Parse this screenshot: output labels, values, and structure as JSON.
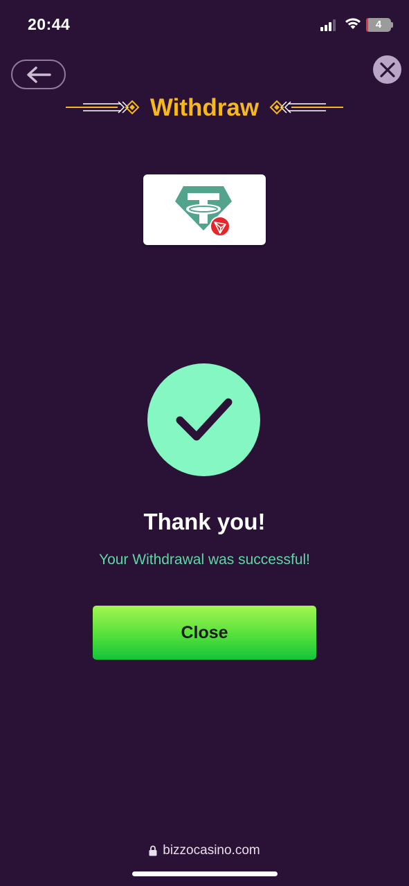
{
  "status_bar": {
    "time": "20:44",
    "battery_level": "4"
  },
  "header": {
    "title": "Withdraw",
    "back_icon": "arrow-left-icon",
    "close_icon": "close-icon"
  },
  "payment_method": {
    "icon": "tether-trc20-icon"
  },
  "result": {
    "icon": "checkmark-icon",
    "title": "Thank you!",
    "message": "Your Withdrawal was successful!",
    "close_label": "Close"
  },
  "browser": {
    "url": "bizzocasino.com",
    "lock_icon": "lock-icon"
  },
  "colors": {
    "background": "#2a1236",
    "accent_gold": "#f6b81c",
    "success_green": "#85f7c3",
    "message_green": "#5fd6a4",
    "button_green": "#54e03b"
  }
}
